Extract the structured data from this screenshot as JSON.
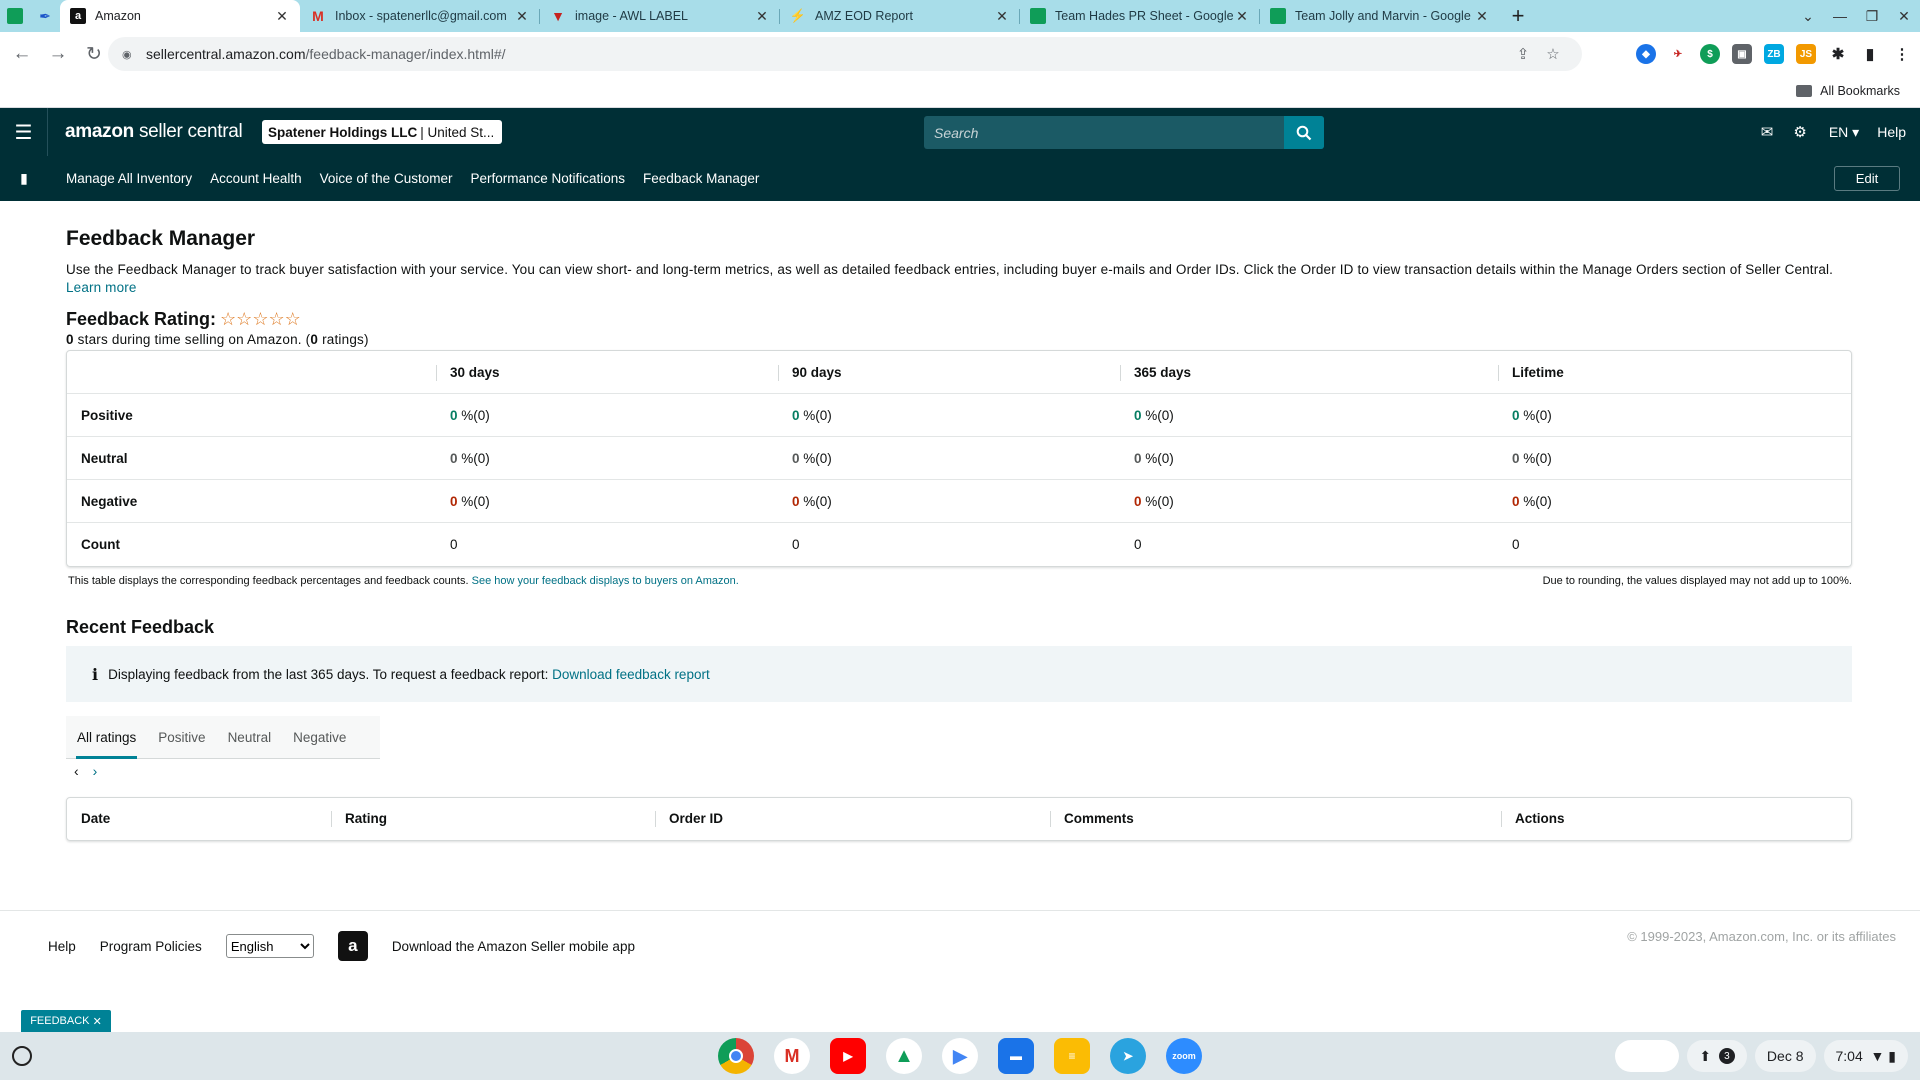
{
  "browser": {
    "tabs": [
      {
        "title": "Amazon",
        "active": true
      },
      {
        "title": "Inbox - spatenerllc@gmail.com",
        "active": false
      },
      {
        "title": "image - AWL LABEL",
        "active": false
      },
      {
        "title": "AMZ EOD Report",
        "active": false
      },
      {
        "title": "Team Hades PR Sheet - Google",
        "active": false
      },
      {
        "title": "Team Jolly and Marvin - Google",
        "active": false
      }
    ],
    "url_host": "sellercentral.amazon.com",
    "url_path": "/feedback-manager/index.html#/",
    "all_bookmarks": "All Bookmarks"
  },
  "header": {
    "logo_brand": "amazon",
    "logo_product": "seller central",
    "account_name": "Spatener Holdings LLC",
    "account_market": "| United St...",
    "search_placeholder": "Search",
    "lang": "EN",
    "help": "Help"
  },
  "nav": {
    "items": [
      "Manage All Inventory",
      "Account Health",
      "Voice of the Customer",
      "Performance Notifications",
      "Feedback Manager"
    ],
    "edit": "Edit"
  },
  "page": {
    "title": "Feedback Manager",
    "description": "Use the Feedback Manager to track buyer satisfaction with your service. You can view short- and long-term metrics, as well as detailed feedback entries, including buyer e-mails and Order IDs. Click the Order ID to view transaction details within the Manage Orders section of Seller Central.",
    "learn_more": "Learn more",
    "rating_label": "Feedback Rating:",
    "rating_stars": 0,
    "rating_summary": {
      "stars": "0",
      "text_mid": "stars during time selling on Amazon. (",
      "ratings": "0",
      "text_end": "ratings)"
    }
  },
  "feedback_table": {
    "columns": [
      "30 days",
      "90 days",
      "365 days",
      "Lifetime"
    ],
    "rows": {
      "positive": {
        "label": "Positive",
        "values": [
          "0",
          "0",
          "0",
          "0"
        ],
        "suffix": "%(0)"
      },
      "neutral": {
        "label": "Neutral",
        "values": [
          "0",
          "0",
          "0",
          "0"
        ],
        "suffix": "%(0)"
      },
      "negative": {
        "label": "Negative",
        "values": [
          "0",
          "0",
          "0",
          "0"
        ],
        "suffix": "%(0)"
      },
      "count": {
        "label": "Count",
        "values": [
          "0",
          "0",
          "0",
          "0"
        ]
      }
    },
    "note": "This table displays the corresponding feedback percentages and feedback counts.",
    "note_link": "See how your feedback displays to buyers on Amazon.",
    "rounding_note": "Due to rounding, the values displayed may not add up to 100%."
  },
  "recent": {
    "title": "Recent Feedback",
    "info_text": "Displaying feedback from the last 365 days. To request a feedback report:",
    "info_link": "Download feedback report",
    "filters": [
      "All ratings",
      "Positive",
      "Neutral",
      "Negative"
    ],
    "active_filter": "All ratings",
    "columns": [
      "Date",
      "Rating",
      "Order ID",
      "Comments",
      "Actions"
    ]
  },
  "footer": {
    "help": "Help",
    "program_policies": "Program Policies",
    "language": "English",
    "app_text": "Download the Amazon Seller mobile app",
    "copyright": "© 1999-2023, Amazon.com, Inc. or its affiliates",
    "feedback_chip": "FEEDBACK"
  },
  "shelf": {
    "date": "Dec 8",
    "time": "7:04",
    "notifications": "3"
  },
  "colors": {
    "header_bg": "#002f36",
    "link": "#007185",
    "positive": "#067d62",
    "negative": "#b12704",
    "accent": "#008296",
    "star": "#de7921"
  }
}
